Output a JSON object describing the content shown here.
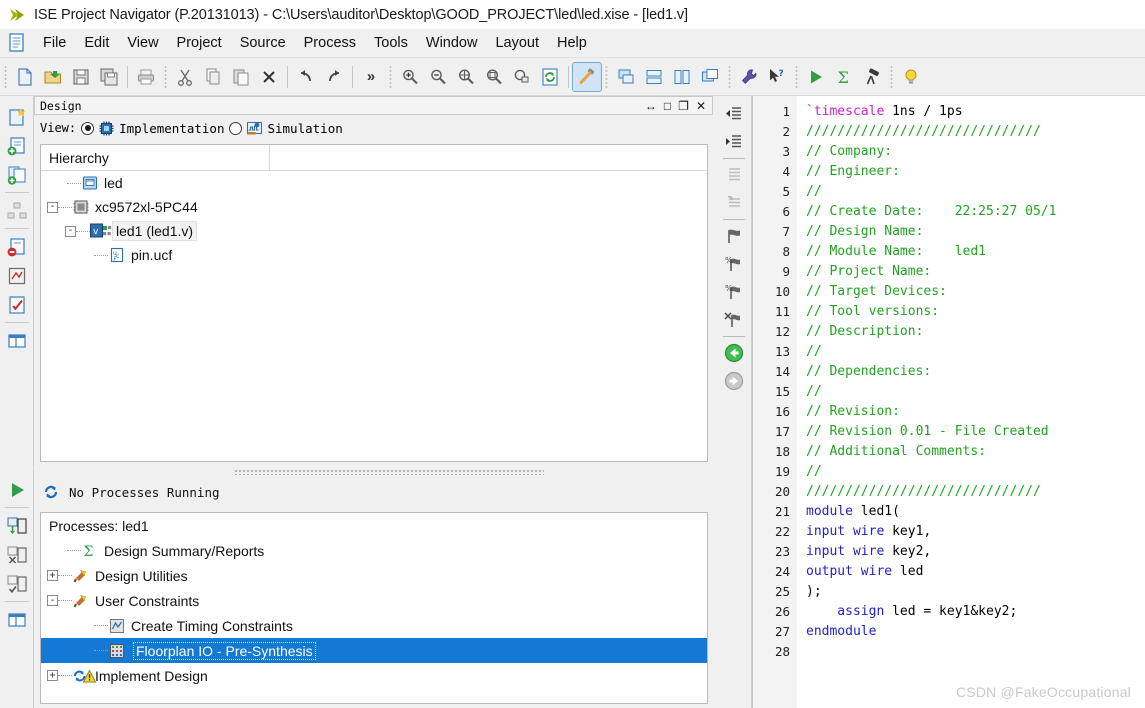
{
  "window": {
    "title": "ISE Project Navigator (P.20131013) - C:\\Users\\auditor\\Desktop\\GOOD_PROJECT\\led\\led.xise - [led1.v]",
    "logo_icon": "ise-arrow-logo-icon"
  },
  "menubar": {
    "doc_icon": "document-icon",
    "items": [
      {
        "label": "File"
      },
      {
        "label": "Edit"
      },
      {
        "label": "View"
      },
      {
        "label": "Project"
      },
      {
        "label": "Source"
      },
      {
        "label": "Process"
      },
      {
        "label": "Tools"
      },
      {
        "label": "Window"
      },
      {
        "label": "Layout"
      },
      {
        "label": "Help"
      }
    ]
  },
  "toolbar": {
    "groups": [
      {
        "buttons": [
          {
            "icon": "new-file-icon",
            "label": "New"
          },
          {
            "icon": "open-folder-icon",
            "label": "Open"
          },
          {
            "icon": "save-icon",
            "label": "Save"
          },
          {
            "icon": "save-all-icon",
            "label": "Save All"
          }
        ]
      },
      {
        "buttons": [
          {
            "icon": "print-icon",
            "label": "Print"
          }
        ]
      },
      {
        "buttons": [
          {
            "icon": "cut-icon",
            "label": "Cut"
          },
          {
            "icon": "copy-icon",
            "label": "Copy"
          },
          {
            "icon": "paste-icon",
            "label": "Paste"
          },
          {
            "icon": "delete-icon",
            "label": "Delete"
          }
        ]
      },
      {
        "buttons": [
          {
            "icon": "undo-icon",
            "label": "Undo"
          },
          {
            "icon": "redo-icon",
            "label": "Redo"
          }
        ]
      },
      {
        "buttons": [
          {
            "icon": "chevron-overflow-icon",
            "label": "»"
          }
        ]
      },
      {
        "buttons": [
          {
            "icon": "zoom-in-icon",
            "label": "Zoom In"
          },
          {
            "icon": "zoom-out-icon",
            "label": "Zoom Out"
          },
          {
            "icon": "zoom-fit-icon",
            "label": "Zoom To Full View"
          },
          {
            "icon": "zoom-selection-icon",
            "label": "Zoom To Selection"
          },
          {
            "icon": "zoom-region-icon",
            "label": "Zoom Region"
          },
          {
            "icon": "refresh-icon",
            "label": "Refresh"
          }
        ]
      },
      {
        "buttons": [
          {
            "icon": "build-hammer-icon",
            "label": "Design Goals and Strategies"
          }
        ]
      },
      {
        "buttons": [
          {
            "icon": "cascade-windows-icon",
            "label": "Cascade"
          },
          {
            "icon": "tile-horizontally-icon",
            "label": "Tile Horizontally"
          },
          {
            "icon": "tile-vertically-icon",
            "label": "Tile Vertically"
          },
          {
            "icon": "float-window-icon",
            "label": "Float"
          }
        ]
      },
      {
        "buttons": [
          {
            "icon": "wrench-icon",
            "label": "Process Properties"
          },
          {
            "icon": "help-pointer-icon",
            "label": "Context Help"
          }
        ]
      },
      {
        "buttons": [
          {
            "icon": "run-play-icon",
            "label": "Implement Top Module"
          },
          {
            "icon": "sigma-icon",
            "label": "Design Summary"
          },
          {
            "icon": "telescope-icon",
            "label": "Analyze Design"
          }
        ]
      },
      {
        "buttons": [
          {
            "icon": "lightbulb-icon",
            "label": "Tip of the Day"
          }
        ]
      }
    ]
  },
  "left_strip_top": {
    "buttons": [
      {
        "icon": "new-source-icon",
        "label": "New Source"
      },
      {
        "icon": "add-source-icon",
        "label": "Add Source"
      },
      {
        "icon": "add-copy-source-icon",
        "label": "Add Copy of Source"
      },
      {
        "icon": "manage-configuration-icon",
        "label": "Manage Configuration"
      },
      {
        "icon": "remove-source-icon",
        "label": "Remove Source"
      },
      {
        "icon": "design-goals-icon",
        "label": "Design Goals"
      },
      {
        "icon": "design-properties-icon",
        "label": "Design Properties"
      },
      {
        "icon": "toggle-panel-icon",
        "label": "Toggle Panel"
      }
    ]
  },
  "left_strip_bottom": {
    "buttons": [
      {
        "icon": "run-play-icon",
        "label": "Run"
      },
      {
        "icon": "rerun-icon",
        "label": "Rerun"
      },
      {
        "icon": "rerun-all-icon",
        "label": "Rerun All"
      },
      {
        "icon": "stop-process-icon",
        "label": "Stop Process"
      },
      {
        "icon": "toggle-panel-icon",
        "label": "Toggle Panel"
      }
    ]
  },
  "design_panel": {
    "title": "Design",
    "title_buttons": [
      {
        "icon": "resize-arrows-icon",
        "glyph": "↔",
        "label": "Resize"
      },
      {
        "icon": "maximize-icon",
        "glyph": "□",
        "label": "Maximize"
      },
      {
        "icon": "restore-icon",
        "glyph": "❐",
        "label": "Restore"
      },
      {
        "icon": "close-icon",
        "glyph": "✕",
        "label": "Close"
      }
    ],
    "view": {
      "label": "View:",
      "options": [
        {
          "label": "Implementation",
          "icon": "chip-icon",
          "selected": true
        },
        {
          "label": "Simulation",
          "icon": "simulation-icon",
          "selected": false
        }
      ]
    },
    "hierarchy": {
      "header": "Hierarchy",
      "rows": [
        {
          "label": "led",
          "icon": "project-folder-icon",
          "depth": 0,
          "expander": "",
          "selected": false
        },
        {
          "label": "xc9572xl-5PC44",
          "icon": "device-chip-icon",
          "depth": 0,
          "expander": "-",
          "selected": false
        },
        {
          "label": "led1 (led1.v)",
          "icon": "verilog-module-icon",
          "depth": 1,
          "expander": "-",
          "selected": true
        },
        {
          "label": "pin.ucf",
          "icon": "ucf-file-icon",
          "depth": 2,
          "expander": "",
          "selected": false
        }
      ]
    }
  },
  "processes_panel": {
    "status": {
      "icon": "refresh-circular-icon",
      "text": "No Processes Running"
    },
    "header": "Processes: led1",
    "rows": [
      {
        "label": "Design Summary/Reports",
        "icon": "sigma-icon",
        "depth": 0,
        "expander": "",
        "selected": false
      },
      {
        "label": "Design Utilities",
        "icon": "process-hammer-icon",
        "depth": 0,
        "expander": "+",
        "selected": false
      },
      {
        "label": "User Constraints",
        "icon": "process-hammer-icon",
        "depth": 0,
        "expander": "-",
        "selected": false
      },
      {
        "label": "Create Timing Constraints",
        "icon": "timing-constraints-icon",
        "depth": 1,
        "expander": "",
        "selected": false
      },
      {
        "label": "Floorplan IO - Pre-Synthesis",
        "icon": "floorplan-io-icon",
        "depth": 1,
        "expander": "",
        "selected": true
      },
      {
        "label": "Implement Design",
        "icon": "implement-warning-icon",
        "depth": 0,
        "expander": "+",
        "selected": false
      }
    ]
  },
  "editor_strip": {
    "buttons": [
      {
        "icon": "outdent-icon",
        "label": "Outdent"
      },
      {
        "icon": "indent-icon",
        "label": "Indent"
      },
      {
        "icon": "comment-lines-icon",
        "label": "Comment"
      },
      {
        "icon": "uncomment-lines-icon",
        "label": "Uncomment"
      },
      {
        "icon": "toggle-bookmark-icon",
        "label": "Toggle Bookmark"
      },
      {
        "icon": "next-bookmark-icon",
        "label": "Next Bookmark"
      },
      {
        "icon": "previous-bookmark-icon",
        "label": "Previous Bookmark"
      },
      {
        "icon": "clear-bookmarks-icon",
        "label": "Clear All Bookmarks"
      },
      {
        "icon": "back-arrow-icon",
        "label": "Back"
      },
      {
        "icon": "forward-arrow-icon",
        "label": "Forward"
      }
    ]
  },
  "editor": {
    "filename": "led1.v",
    "lines": [
      {
        "n": 1,
        "segments": [
          {
            "t": "`timescale ",
            "c": "dir"
          },
          {
            "t": "1ns / 1ps",
            "c": "pl"
          }
        ]
      },
      {
        "n": 2,
        "segments": [
          {
            "t": "//////////////////////////////",
            "c": "cm"
          }
        ]
      },
      {
        "n": 3,
        "segments": [
          {
            "t": "// Company:",
            "c": "cm"
          }
        ]
      },
      {
        "n": 4,
        "segments": [
          {
            "t": "// Engineer:",
            "c": "cm"
          }
        ]
      },
      {
        "n": 5,
        "segments": [
          {
            "t": "//",
            "c": "cm"
          }
        ]
      },
      {
        "n": 6,
        "segments": [
          {
            "t": "// Create Date:    22:25:27 05/1",
            "c": "cm"
          }
        ]
      },
      {
        "n": 7,
        "segments": [
          {
            "t": "// Design Name:",
            "c": "cm"
          }
        ]
      },
      {
        "n": 8,
        "segments": [
          {
            "t": "// Module Name:    led1",
            "c": "cm"
          }
        ]
      },
      {
        "n": 9,
        "segments": [
          {
            "t": "// Project Name:",
            "c": "cm"
          }
        ]
      },
      {
        "n": 10,
        "segments": [
          {
            "t": "// Target Devices:",
            "c": "cm"
          }
        ]
      },
      {
        "n": 11,
        "segments": [
          {
            "t": "// Tool versions:",
            "c": "cm"
          }
        ]
      },
      {
        "n": 12,
        "segments": [
          {
            "t": "// Description:",
            "c": "cm"
          }
        ]
      },
      {
        "n": 13,
        "segments": [
          {
            "t": "//",
            "c": "cm"
          }
        ]
      },
      {
        "n": 14,
        "segments": [
          {
            "t": "// Dependencies:",
            "c": "cm"
          }
        ]
      },
      {
        "n": 15,
        "segments": [
          {
            "t": "//",
            "c": "cm"
          }
        ]
      },
      {
        "n": 16,
        "segments": [
          {
            "t": "// Revision:",
            "c": "cm"
          }
        ]
      },
      {
        "n": 17,
        "segments": [
          {
            "t": "// Revision 0.01 - File Created",
            "c": "cm"
          }
        ]
      },
      {
        "n": 18,
        "segments": [
          {
            "t": "// Additional Comments:",
            "c": "cm"
          }
        ]
      },
      {
        "n": 19,
        "segments": [
          {
            "t": "//",
            "c": "cm"
          }
        ]
      },
      {
        "n": 20,
        "segments": [
          {
            "t": "//////////////////////////////",
            "c": "cm"
          }
        ]
      },
      {
        "n": 21,
        "segments": [
          {
            "t": "module ",
            "c": "kw"
          },
          {
            "t": "led1(",
            "c": "pl"
          }
        ]
      },
      {
        "n": 22,
        "segments": [
          {
            "t": "input wire ",
            "c": "kw"
          },
          {
            "t": "key1,",
            "c": "pl"
          }
        ]
      },
      {
        "n": 23,
        "segments": [
          {
            "t": "input wire ",
            "c": "kw"
          },
          {
            "t": "key2,",
            "c": "pl"
          }
        ]
      },
      {
        "n": 24,
        "segments": [
          {
            "t": "output wire ",
            "c": "kw"
          },
          {
            "t": "led",
            "c": "pl"
          }
        ]
      },
      {
        "n": 25,
        "segments": [
          {
            "t": ");",
            "c": "pl"
          }
        ]
      },
      {
        "n": 26,
        "segments": [
          {
            "t": "    assign ",
            "c": "kw"
          },
          {
            "t": "led = key1&key2;",
            "c": "pl"
          }
        ]
      },
      {
        "n": 27,
        "segments": [
          {
            "t": "endmodule",
            "c": "kw"
          }
        ]
      },
      {
        "n": 28,
        "segments": [
          {
            "t": "",
            "c": "pl"
          }
        ]
      }
    ]
  },
  "watermark": {
    "text": "CSDN @FakeOccupational"
  },
  "colors": {
    "selection_blue": "#1479d4",
    "comment_green": "#22a322",
    "keyword_blue": "#2222cc",
    "directive_magenta": "#cc22cc",
    "panel_bg": "#f0f0f0"
  }
}
